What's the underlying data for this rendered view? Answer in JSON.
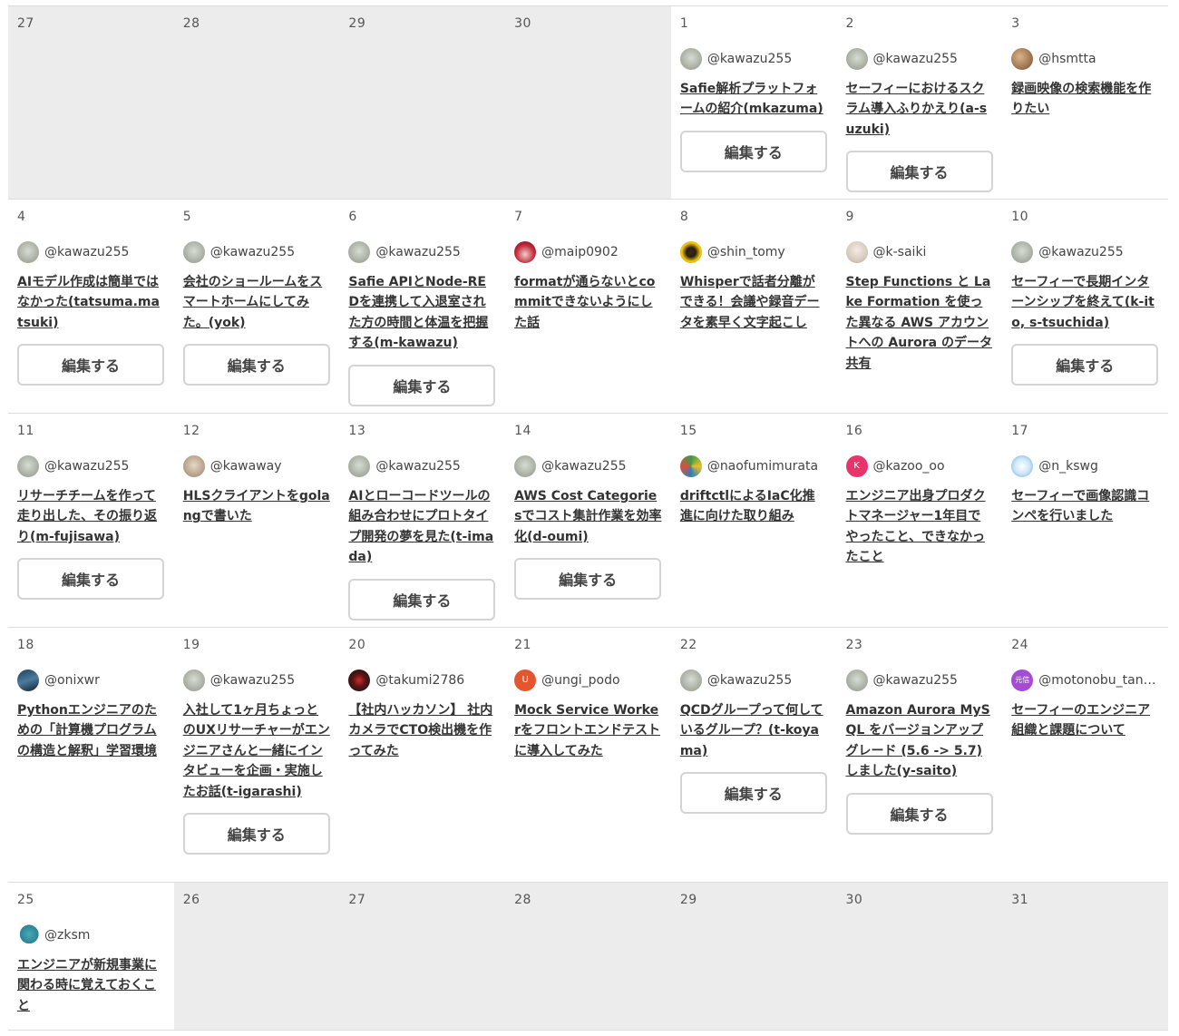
{
  "edit_label": "編集する",
  "weeks": [
    {
      "height": 212,
      "days": [
        {
          "num": "27",
          "empty": true
        },
        {
          "num": "28",
          "empty": true
        },
        {
          "num": "29",
          "empty": true
        },
        {
          "num": "30",
          "empty": true
        },
        {
          "num": "1",
          "user": "@kawazu255",
          "avatar": "kawazu",
          "title": "Safie解析プラットフォームの紹介(mkazuma)",
          "edit": true
        },
        {
          "num": "2",
          "user": "@kawazu255",
          "avatar": "kawazu",
          "title": "セーフィーにおけるスクラム導入ふりかえり(a-suzuki)",
          "edit": true
        },
        {
          "num": "3",
          "user": "@hsmtta",
          "avatar": "cat",
          "title": "録画映像の検索機能を作りたい"
        }
      ]
    },
    {
      "height": 235,
      "days": [
        {
          "num": "4",
          "user": "@kawazu255",
          "avatar": "kawazu",
          "title": "AIモデル作成は簡単ではなかった(tatsuma.matsuki)",
          "edit": true
        },
        {
          "num": "5",
          "user": "@kawazu255",
          "avatar": "kawazu",
          "title": "会社のショールームをスマートホームにしてみた。(yok)",
          "edit": true
        },
        {
          "num": "6",
          "user": "@kawazu255",
          "avatar": "kawazu",
          "title": "Safie APIとNode-REDを連携して入退室された方の時間と体温を把握する(m-kawazu)",
          "edit": true
        },
        {
          "num": "7",
          "user": "@maip0902",
          "avatar": "anime",
          "title": "formatが通らないとcommitできないようにした話"
        },
        {
          "num": "8",
          "user": "@shin_tomy",
          "avatar": "yellow",
          "title": "Whisperで話者分離ができる！会議や録音データを素早く文字起こし"
        },
        {
          "num": "9",
          "user": "@k-saiki",
          "avatar": "photo",
          "title": "Step Functions と Lake Formation を使った異なる AWS アカウントへの Aurora のデータ共有"
        },
        {
          "num": "10",
          "user": "@kawazu255",
          "avatar": "kawazu",
          "title": "セーフィーで長期インターンシップを終えて(k-ito, s-tsuchida)",
          "edit": true
        }
      ]
    },
    {
      "height": 235,
      "days": [
        {
          "num": "11",
          "user": "@kawazu255",
          "avatar": "kawazu",
          "title": "リサーチチームを作って走り出した、その振り返り(m-fujisawa)",
          "edit": true
        },
        {
          "num": "12",
          "user": "@kawaway",
          "avatar": "face",
          "title": "HLSクライアントをgolangで書いた"
        },
        {
          "num": "13",
          "user": "@kawazu255",
          "avatar": "kawazu",
          "title": "AIとローコードツールの組み合わせにプロトタイプ開発の夢を見た(t-imada)",
          "edit": true
        },
        {
          "num": "14",
          "user": "@kawazu255",
          "avatar": "kawazu",
          "title": "AWS Cost Categoriesでコスト集計作業を効率化(d-oumi)",
          "edit": true
        },
        {
          "num": "15",
          "user": "@naofumimurata",
          "avatar": "colorful",
          "title": "driftctlによるIaC化推進に向けた取り組み"
        },
        {
          "num": "16",
          "user": "@kazoo_oo",
          "avatar": "k",
          "title": "エンジニア出身プロダクトマネージャー1年目でやったこと、できなかったこと"
        },
        {
          "num": "17",
          "user": "@n_kswg",
          "avatar": "plane",
          "title": "セーフィーで画像認識コンペを行いました"
        }
      ]
    },
    {
      "height": 280,
      "days": [
        {
          "num": "18",
          "user": "@onixwr",
          "avatar": "car",
          "title": "Pythonエンジニアのための「計算機プログラムの構造と解釈」学習環境"
        },
        {
          "num": "19",
          "user": "@kawazu255",
          "avatar": "kawazu",
          "title": "入社して1ヶ月ちょっとのUXリサーチャーがエンジニアさんと一緒にインタビューを企画・実施したお話(t-igarashi)",
          "edit": true
        },
        {
          "num": "20",
          "user": "@takumi2786",
          "avatar": "dark",
          "title": "【社内ハッカソン】 社内カメラでCTO検出機を作ってみた"
        },
        {
          "num": "21",
          "user": "@ungi_podo",
          "avatar": "u",
          "title": "Mock Service Workerをフロントエンドテストに導入してみた"
        },
        {
          "num": "22",
          "user": "@kawazu255",
          "avatar": "kawazu",
          "title": "QCDグループって何しているグループ？(t-koyama)",
          "edit": true
        },
        {
          "num": "23",
          "user": "@kawazu255",
          "avatar": "kawazu",
          "title": "Amazon Aurora MySQL をバージョンアップグレード (5.6 -> 5.7) しました(y-saito)",
          "edit": true
        },
        {
          "num": "24",
          "user": "@motonobu_tani...",
          "avatar": "motonobu",
          "title": "セーフィーのエンジニア組織と課題について"
        }
      ]
    },
    {
      "height": 162,
      "days": [
        {
          "num": "25",
          "user": "@zksm",
          "avatar": "bird",
          "title": "エンジニアが新規事業に関わる時に覚えておくこと"
        },
        {
          "num": "26",
          "empty": true
        },
        {
          "num": "27",
          "empty": true
        },
        {
          "num": "28",
          "empty": true
        },
        {
          "num": "29",
          "empty": true
        },
        {
          "num": "30",
          "empty": true
        },
        {
          "num": "31",
          "empty": true
        }
      ]
    }
  ],
  "avatar_styles": {
    "kawazu": {
      "background": "radial-gradient(circle at 50% 45%, #d8dcd4 0%, #aab1a4 60%, #8e9788 100%)",
      "text": ""
    },
    "cat": {
      "background": "radial-gradient(circle at 40% 40%, #d9b48a 0%, #a07650 60%, #6a4a30 100%)",
      "text": ""
    },
    "anime": {
      "background": "radial-gradient(circle at 50% 60%, #f2cfc6 0%, #c0283a 55%, #7a1020 100%)",
      "text": ""
    },
    "yellow": {
      "background": "radial-gradient(circle at 50% 50%, #3a2a10 0%, #2a1e0a 30%, #f1c40f 60%, #d4a700 100%)",
      "text": ""
    },
    "photo": {
      "background": "radial-gradient(circle at 50% 40%, #f3ece5 0%, #d6cabd 60%, #b3a391 100%)",
      "text": ""
    },
    "face": {
      "background": "radial-gradient(circle at 50% 45%, #e6d8c6 0%, #b9a48e 60%, #8d7a66 100%)",
      "text": ""
    },
    "colorful": {
      "background": "conic-gradient(#3d9b4a, #e8c227, #2e7fb8, #d9513c, #3d9b4a)",
      "text": ""
    },
    "k": {
      "background": "#e8336d",
      "text": "K"
    },
    "plane": {
      "background": "radial-gradient(circle at 50% 50%, #ffffff 0%, #cde6f7 50%, #5aa6de 100%)",
      "text": ""
    },
    "car": {
      "background": "linear-gradient(160deg, #1e3d5a 0%, #4d7b9e 50%, #0f1f30 100%)",
      "text": ""
    },
    "dark": {
      "background": "radial-gradient(circle at 50% 50%, #d42b2b 0%, #5a1515 40%, #111111 100%)",
      "text": ""
    },
    "u": {
      "background": "#e4572e",
      "text": "U"
    },
    "motonobu": {
      "background": "#a64bd6",
      "text": "元信"
    },
    "bird": {
      "background": "radial-gradient(circle at 55% 45%, #4aa8b8 0%, #2a8496 55%, #ffffff 56%)",
      "text": ""
    }
  }
}
